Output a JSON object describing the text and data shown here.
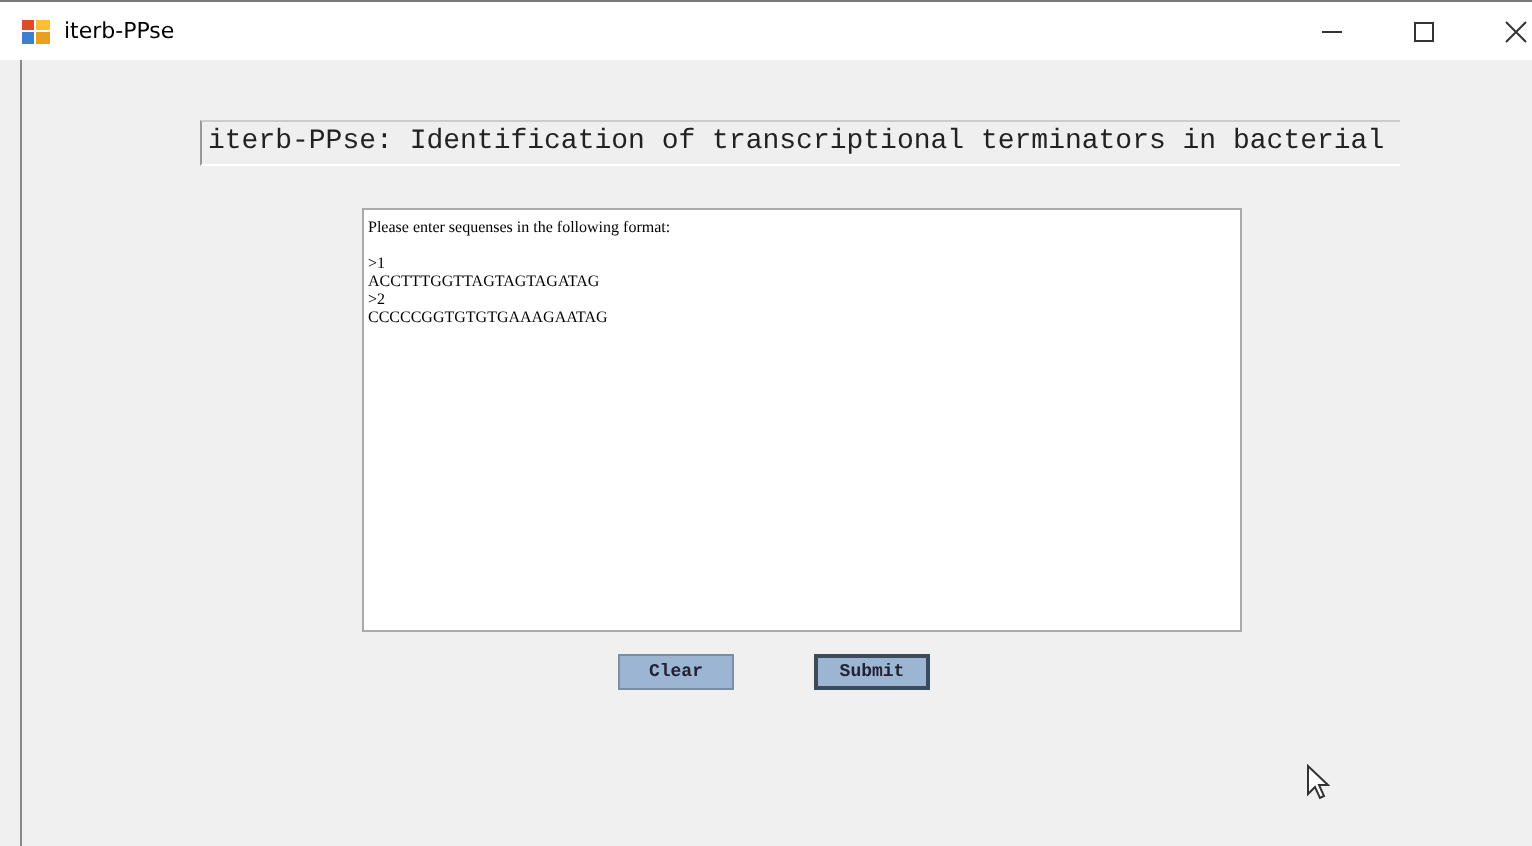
{
  "window": {
    "title": "iterb-PPse"
  },
  "heading": "iterb-PPse: Identification of transcriptional terminators in bacterial",
  "sequence_input": {
    "value": "Please enter sequenses in the following format:\n\n>1\nACCTTTGGTTAGTAGTAGATAG\n>2\nCCCCCGGTGTGTGAAAGAATAG"
  },
  "buttons": [
    {
      "label": "Clear",
      "focused": false
    },
    {
      "label": "Submit",
      "focused": true
    }
  ]
}
